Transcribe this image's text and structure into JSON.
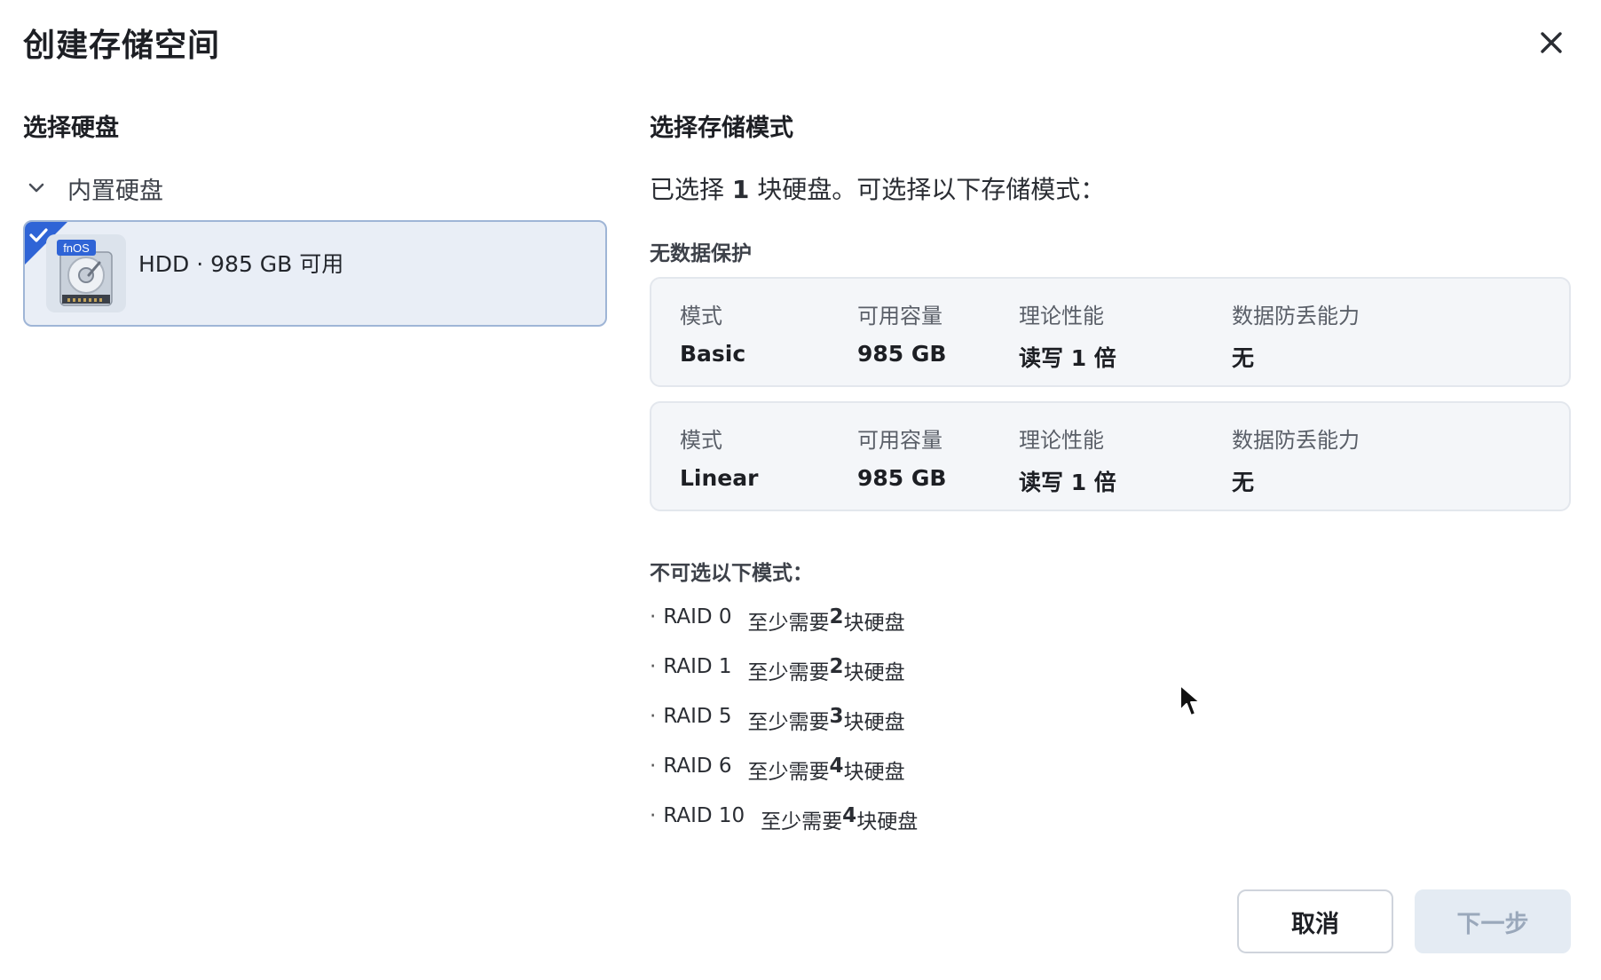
{
  "dialog": {
    "title": "创建存储空间"
  },
  "left": {
    "heading": "选择硬盘",
    "group_label": "内置硬盘",
    "disk": {
      "badge": "fnOS",
      "label": "HDD · 985 GB 可用",
      "selected": true
    }
  },
  "right": {
    "heading": "选择存储模式",
    "summary_prefix": "已选择 ",
    "summary_count": "1",
    "summary_suffix": " 块硬盘。可选择以下存储模式：",
    "no_protection_heading": "无数据保护",
    "modes": [
      {
        "h_mode": "模式",
        "h_capacity": "可用容量",
        "h_performance": "理论性能",
        "h_protection": "数据防丢能力",
        "mode": "Basic",
        "capacity": "985 GB",
        "performance": "读写 1 倍",
        "protection": "无"
      },
      {
        "h_mode": "模式",
        "h_capacity": "可用容量",
        "h_performance": "理论性能",
        "h_protection": "数据防丢能力",
        "mode": "Linear",
        "capacity": "985 GB",
        "performance": "读写 1 倍",
        "protection": "无"
      }
    ],
    "unavailable_heading": "不可选以下模式：",
    "unavailable": [
      {
        "bullet": "·",
        "name": "RAID 0",
        "prefix": "至少需要 ",
        "count": "2",
        "suffix": " 块硬盘"
      },
      {
        "bullet": "·",
        "name": "RAID 1",
        "prefix": "至少需要 ",
        "count": "2",
        "suffix": " 块硬盘"
      },
      {
        "bullet": "·",
        "name": "RAID 5",
        "prefix": "至少需要 ",
        "count": "3",
        "suffix": " 块硬盘"
      },
      {
        "bullet": "·",
        "name": "RAID 6",
        "prefix": "至少需要 ",
        "count": "4",
        "suffix": " 块硬盘"
      },
      {
        "bullet": "·",
        "name": "RAID 10",
        "prefix": "至少需要 ",
        "count": "4",
        "suffix": " 块硬盘"
      }
    ]
  },
  "footer": {
    "cancel_label": "取消",
    "next_label": "下一步",
    "next_disabled": true
  },
  "colors": {
    "selected_bg": "#e9eef6",
    "selected_border": "#9fb5d6",
    "check_blue": "#2f64d6",
    "card_bg": "#f4f6f9",
    "disabled_btn_bg": "#e4ebf3"
  }
}
